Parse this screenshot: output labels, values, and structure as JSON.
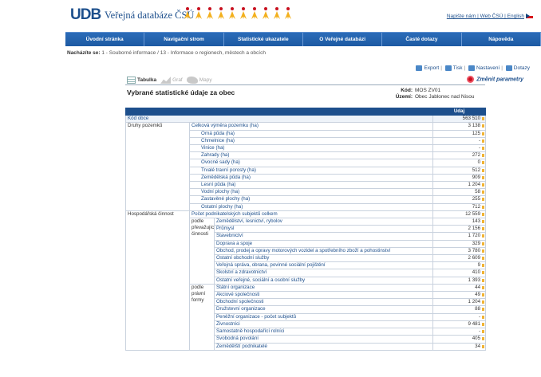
{
  "header": {
    "logo": "UDB",
    "title": "Veřejná databáze ČSÚ",
    "links": "Napište nám | Web ČSÚ | English"
  },
  "nav": [
    "Úvodní stránka",
    "Navigační strom",
    "Statistické ukazatele",
    "O Veřejné databázi",
    "Časté dotazy",
    "Nápověda"
  ],
  "breadcrumb": {
    "label": "Nacházíte se:",
    "path": "1 - Souborné informace / 13 - Informace o regionech, městech a obcích"
  },
  "toolbar": {
    "export": "Export",
    "print": "Tisk",
    "settings": "Nastavení",
    "queries": "Dotazy",
    "change_params": "Změnit parametry"
  },
  "view_tabs": {
    "table": "Tabulka",
    "graph": "Graf",
    "map": "Mapy"
  },
  "page_title": "Vybrané statistické údaje za obec",
  "meta": {
    "code_label": "Kód:",
    "code_value": "MOS ZV01",
    "area_label": "Území:",
    "area_value": "Obec Jablonec nad Nisou"
  },
  "table": {
    "value_header": "Údaj",
    "code_row": {
      "label": "Kód obce",
      "value": "563 510"
    },
    "groups": [
      {
        "name": "Druhy pozemků",
        "rows": [
          {
            "label": "Celková výměra pozemku (ha)",
            "indent": false,
            "value": "3 138"
          },
          {
            "label": "Orná půda (ha)",
            "indent": true,
            "value": "125"
          },
          {
            "label": "Chmelnice (ha)",
            "indent": true,
            "value": "-"
          },
          {
            "label": "Vinice (ha)",
            "indent": true,
            "value": "-"
          },
          {
            "label": "Zahrady (ha)",
            "indent": true,
            "value": "272"
          },
          {
            "label": "Ovocné sady (ha)",
            "indent": true,
            "value": "0"
          },
          {
            "label": "Trvalé travní porosty (ha)",
            "indent": true,
            "value": "512"
          },
          {
            "label": "Zemědělská půda (ha)",
            "indent": true,
            "value": "909"
          },
          {
            "label": "Lesní půda (ha)",
            "indent": true,
            "value": "1 204"
          },
          {
            "label": "Vodní plochy (ha)",
            "indent": true,
            "value": "58"
          },
          {
            "label": "Zastavěné plochy (ha)",
            "indent": true,
            "value": "255"
          },
          {
            "label": "Ostatní plochy (ha)",
            "indent": true,
            "value": "712"
          }
        ]
      },
      {
        "name": "Hospodářská činnost",
        "total": {
          "label": "Počet podnikatelských subjektů celkem",
          "value": "12 559"
        },
        "subgroups": [
          {
            "name": "podle převažující činnosti",
            "rows": [
              {
                "label": "Zemědělství, lesnictví, rybolov",
                "value": "143"
              },
              {
                "label": "Průmysl",
                "value": "2 156"
              },
              {
                "label": "Stavebnictví",
                "value": "1 720"
              },
              {
                "label": "Doprava a spoje",
                "value": "329"
              },
              {
                "label": "Obchod, prodej a opravy motorových vozidel a spotřebního zboží a pohostinství",
                "value": "3 780"
              },
              {
                "label": "Ostatní obchodní služby",
                "value": "2 609"
              },
              {
                "label": "Veřejná správa, obrana, povinné sociální pojištění",
                "value": "9"
              },
              {
                "label": "Školství a zdravotnictví",
                "value": "410"
              },
              {
                "label": "Ostatní veřejné, sociální a osobní služby",
                "value": "1 393"
              }
            ]
          },
          {
            "name": "podle právní formy",
            "rows": [
              {
                "label": "Státní organizace",
                "value": "44"
              },
              {
                "label": "Akciové společnosti",
                "value": "49"
              },
              {
                "label": "Obchodní společnosti",
                "value": "1 204"
              },
              {
                "label": "Družstevní organizace",
                "value": "88"
              },
              {
                "label": "Peněžní organizace - počet subjektů",
                "value": "-"
              },
              {
                "label": "Živnostníci",
                "value": "9 481"
              },
              {
                "label": "Samostatně hospodařící rolníci",
                "value": "-"
              },
              {
                "label": "Svobodná povolání",
                "value": "405"
              },
              {
                "label": "Zemědělští podnikatelé",
                "value": "34"
              }
            ]
          }
        ]
      }
    ]
  }
}
